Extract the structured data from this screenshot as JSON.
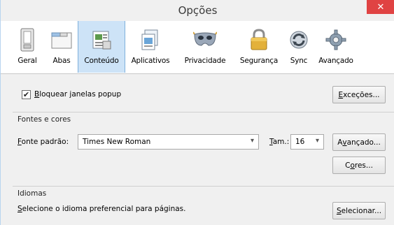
{
  "window": {
    "title": "Opções",
    "close_glyph": "✕"
  },
  "toolbar": {
    "tabs": [
      {
        "label": "Geral",
        "icon": "switch-icon",
        "selected": false
      },
      {
        "label": "Abas",
        "icon": "tabs-window-icon",
        "selected": false
      },
      {
        "label": "Conteúdo",
        "icon": "content-page-icon",
        "selected": true
      },
      {
        "label": "Aplicativos",
        "icon": "applications-icon",
        "selected": false
      },
      {
        "label": "Privacidade",
        "icon": "mask-icon",
        "selected": false
      },
      {
        "label": "Segurança",
        "icon": "padlock-icon",
        "selected": false
      },
      {
        "label": "Sync",
        "icon": "sync-icon",
        "selected": false
      },
      {
        "label": "Avançado",
        "icon": "gear-icon",
        "selected": false
      }
    ]
  },
  "popup": {
    "checkbox_checked": true,
    "check_glyph": "✔",
    "label_first": "B",
    "label_rest": "loquear janelas popup",
    "exceptions_first": "E",
    "exceptions_rest": "xceções..."
  },
  "fonts": {
    "section_title": "Fontes e cores",
    "default_font_first": "F",
    "default_font_rest": "onte padrão:",
    "default_font_value": "Times New Roman",
    "size_first": "T",
    "size_rest": "am.:",
    "size_value": "16",
    "advanced_a": "A",
    "advanced_v": "v",
    "advanced_rest": "ançado...",
    "colors_c": "C",
    "colors_o": "o",
    "colors_rest": "res..."
  },
  "languages": {
    "section_title": "Idiomas",
    "description_first": "S",
    "description_rest": "elecione o idioma preferencial para páginas.",
    "select_first": "S",
    "select_rest": "elecionar..."
  },
  "colors": {
    "selected_tab_bg": "#cde3f7",
    "close_button": "#e04343"
  }
}
